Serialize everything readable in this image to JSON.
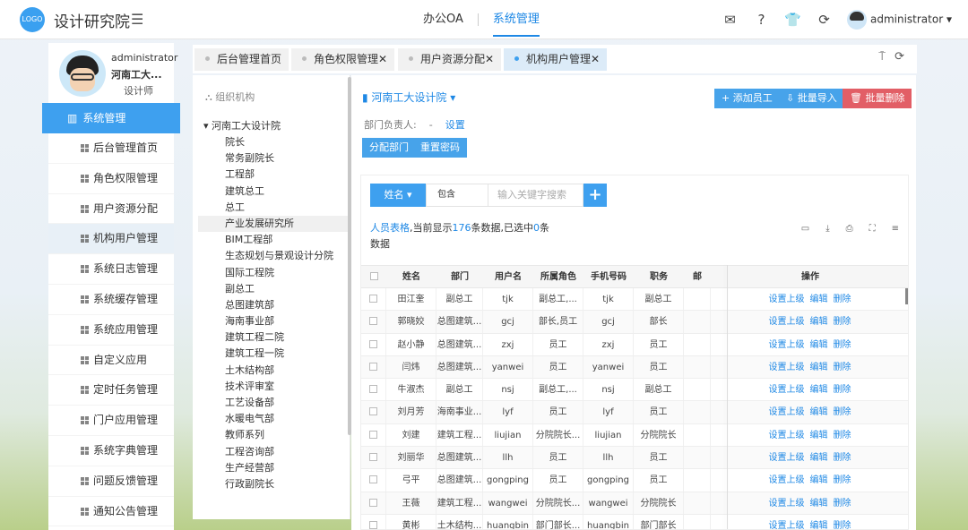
{
  "app": {
    "logo": "LOGO",
    "title": "设计研究院"
  },
  "top_nav": {
    "items": [
      "办公OA",
      "系统管理"
    ],
    "active": "系统管理"
  },
  "top_user": {
    "name": "administrator"
  },
  "profile": {
    "name": "administrator",
    "org": "河南工大...",
    "role": "设计师"
  },
  "sidebar": {
    "section": "系统管理",
    "items": [
      "后台管理首页",
      "角色权限管理",
      "用户资源分配",
      "机构用户管理",
      "系统日志管理",
      "系统缓存管理",
      "系统应用管理",
      "自定义应用",
      "定时任务管理",
      "门户应用管理",
      "系统字典管理",
      "问题反馈管理",
      "通知公告管理"
    ],
    "selected": "机构用户管理"
  },
  "tabs": [
    {
      "label": "后台管理首页"
    },
    {
      "label": "角色权限管理✕"
    },
    {
      "label": "用户资源分配✕"
    },
    {
      "label": "机构用户管理✕"
    }
  ],
  "tree": {
    "title": "组织机构",
    "root": "河南工大设计院",
    "nodes": [
      "院长",
      "常务副院长",
      "工程部",
      "建筑总工",
      "总工",
      "产业发展研究所",
      "BIM工程部",
      "生态规划与景观设计分院",
      "国际工程院",
      "副总工",
      "总图建筑部",
      "海南事业部",
      "建筑工程二院",
      "建筑工程一院",
      "土木结构部",
      "技术评审室",
      "工艺设备部",
      "水暖电气部",
      "教师系列",
      "工程咨询部",
      "生产经营部",
      "行政副院长"
    ]
  },
  "main": {
    "dept_title": "河南工大设计院",
    "dept_head_label": "部门负责人:",
    "dept_head_value": "-",
    "dept_head_link": "设置",
    "buttons": {
      "add": "+ 添加员工",
      "import": "⇩ 批量导入",
      "delete": "批量删除",
      "assign": "分配部门",
      "reset": "重置密码"
    }
  },
  "filter": {
    "field": "姓名 ▾",
    "operator": "包含",
    "placeholder": "输入关键字搜索",
    "add": "+"
  },
  "summary": {
    "prefix": "人员表格,当前显示",
    "count": "176",
    "middle": "条数据,已选中",
    "selected": "0",
    "suffix": "条数据"
  },
  "table": {
    "headers": [
      "",
      "姓名",
      "部门",
      "用户名",
      "所属角色",
      "手机号码",
      "职务",
      "邮",
      "操作"
    ],
    "ops": [
      "设置上级",
      "编辑",
      "删除"
    ],
    "rows": [
      [
        "田江奎",
        "副总工",
        "tjk",
        "副总工,...",
        "tjk",
        "副总工"
      ],
      [
        "郭晓姣",
        "总图建筑...",
        "gcj",
        "部长,员工",
        "gcj",
        "部长"
      ],
      [
        "赵小静",
        "总图建筑...",
        "zxj",
        "员工",
        "zxj",
        "员工"
      ],
      [
        "闫炜",
        "总图建筑...",
        "yanwei",
        "员工",
        "yanwei",
        "员工"
      ],
      [
        "牛淑杰",
        "副总工",
        "nsj",
        "副总工,...",
        "nsj",
        "副总工"
      ],
      [
        "刘月芳",
        "海南事业...",
        "lyf",
        "员工",
        "lyf",
        "员工"
      ],
      [
        "刘建",
        "建筑工程...",
        "liujian",
        "分院院长...",
        "liujian",
        "分院院长"
      ],
      [
        "刘丽华",
        "总图建筑...",
        "llh",
        "员工",
        "llh",
        "员工"
      ],
      [
        "弓平",
        "总图建筑...",
        "gongping",
        "员工",
        "gongping",
        "员工"
      ],
      [
        "王薇",
        "建筑工程...",
        "wangwei",
        "分院院长...",
        "wangwei",
        "分院院长"
      ],
      [
        "黄彬",
        "土木结构...",
        "huangbin",
        "部门部长...",
        "huangbin",
        "部门部长"
      ]
    ]
  }
}
